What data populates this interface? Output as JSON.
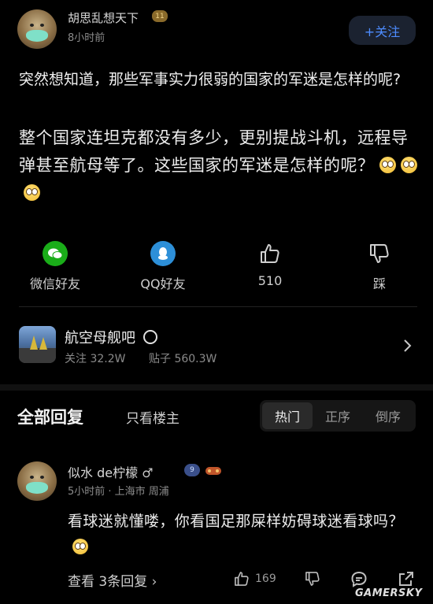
{
  "post": {
    "author": "胡思乱想天下",
    "level": "11",
    "time": "8小时前",
    "follow_label": "+关注",
    "title": "突然想知道，那些军事实力很弱的国家的军迷是怎样的呢?",
    "body": "整个国家连坦克都没有多少，更别提战斗机，远程导弹甚至航母等了。这些国家的军迷是怎样的呢？"
  },
  "share": {
    "wechat_label": "微信好友",
    "qq_label": "QQ好友",
    "like_count": "510",
    "dislike_label": "踩"
  },
  "forum": {
    "name": "航空母舰吧",
    "followers": "关注 32.2W",
    "posts": "贴子 560.3W"
  },
  "replies_header": {
    "all": "全部回复",
    "only_op": "只看楼主",
    "sort_hot": "热门",
    "sort_asc": "正序",
    "sort_desc": "倒序"
  },
  "comment": {
    "name": "似水 de柠檬",
    "gender": "♂",
    "level": "9",
    "meta": "5小时前 · 上海市 周浦",
    "text": "看球迷就懂喽，你看国足那屎样妨碍球迷看球吗？",
    "view_replies": "查看 3条回复",
    "like_count": "169"
  },
  "watermark": "GAMERSKY",
  "colors": {
    "background": "#000000",
    "accent": "#4d8cff",
    "wechat": "#1aad19",
    "qq": "#2d8fd8"
  }
}
